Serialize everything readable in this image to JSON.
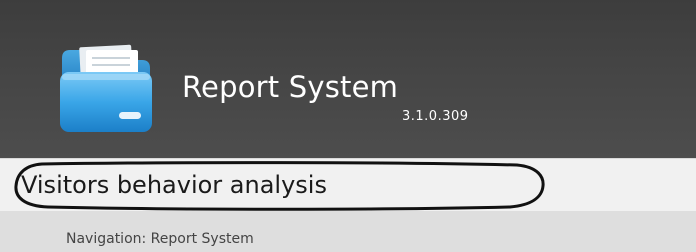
{
  "header": {
    "app_title": "Report System",
    "version": "3.1.0.309",
    "logo_icon": "folder-icon",
    "background_color": "#454545"
  },
  "page": {
    "title": "Visitors behavior analysis"
  },
  "navigation": {
    "label": "Navigation:",
    "path": "Report System",
    "breadcrumb_text": "Navigation: Report System"
  },
  "colors": {
    "logo_blue": "#3aa6e8",
    "title_bar": "#f1f1f1",
    "nav_bar": "#dedede"
  }
}
